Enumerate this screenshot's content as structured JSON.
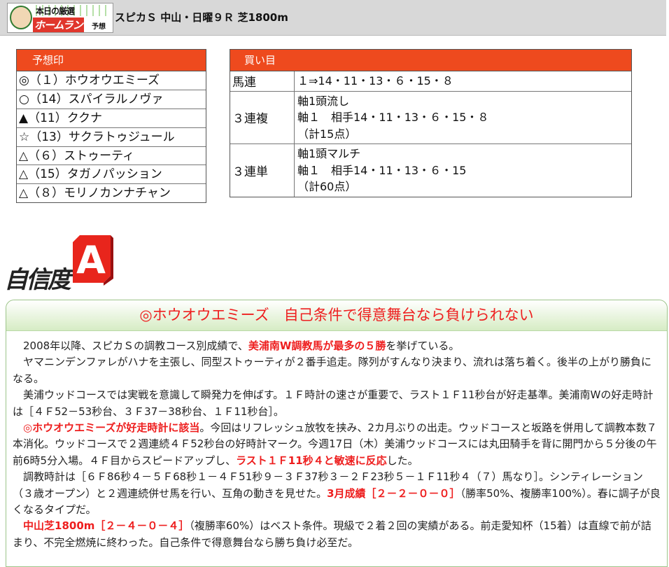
{
  "header": {
    "logo": {
      "line1": "本日の厳選",
      "line2": "ホームラン",
      "line3": "予想"
    },
    "race_title": "スピカＳ 中山・日曜９Ｒ 芝1800m"
  },
  "marks": {
    "heading": "予想印",
    "rows": [
      "◎（１）ホウオウエミーズ",
      "○（14）スパイラルノヴァ",
      "▲（11）ククナ",
      "☆（13）サクラトゥジュール",
      "△（６）ストゥーティ",
      "△（15）タガノパッション",
      "△（８）モリノカンナチャン"
    ]
  },
  "bets": {
    "heading": "買い目",
    "rows": [
      {
        "type": "馬連",
        "lines": [
          "１⇒14・11・13・６・15・８"
        ]
      },
      {
        "type": "３連複",
        "lines": [
          "軸1頭流し",
          "軸１　相手14・11・13・６・15・８",
          "（計15点）"
        ]
      },
      {
        "type": "３連単",
        "lines": [
          "軸1頭マルチ",
          "軸１　相手14・11・13・６・15",
          "（計60点）"
        ]
      }
    ]
  },
  "confidence": {
    "label": "自信度",
    "grade": "A"
  },
  "article": {
    "headline": "◎ホウオウエミーズ　自己条件で得意舞台なら負けられない",
    "p1": [
      "　2008年以降、スピカＳの調教コース別成績で、",
      "美浦南W調教馬が最多の５勝",
      "を挙げている。"
    ],
    "p2": "　ヤマニンデンファレがハナを主張し、同型ストゥーティが２番手追走。隊列がすんなり決まり、流れは落ち着く。後半の上がり勝負になる。",
    "p3": "　美浦ウッドコースでは実戦を意識して瞬発力を伸ばす。１Ｆ時計の速さが重要で、ラスト１Ｆ11秒台が好走基準。美浦南Wの好走時計は［４Ｆ52－53秒台、３Ｆ37－38秒台、１Ｆ11秒台］。",
    "p4": [
      "　",
      "◎ホウオウエミーズが好走時計に該当",
      "。今回はリフレッシュ放牧を挟み、2カ月ぶりの出走。ウッドコースと坂路を併用して調教本数７本消化。ウッドコースで２週連続４Ｆ52秒台の好時計マーク。今週17日（木）美浦ウッドコースには丸田騎手を背に開門から５分後の午前6時5分入場。４Ｆ目からスピードアップし、",
      "ラスト１Ｆ11秒４と敏速に反応",
      "した。"
    ],
    "p5": [
      "　調教時計は［６Ｆ86秒４－５Ｆ68秒１－４Ｆ51秒９－３Ｆ37秒３－２Ｆ23秒５－１Ｆ11秒４（７）馬なり］。シンティレーション（３歳オープン）と２週連続併せ馬を行い、互角の動きを見せた。",
      "3月成績［２－２－０－０］",
      "（勝率50%、複勝率100%）。春に調子が良くなるタイプだ。"
    ],
    "p6": [
      "　",
      "中山芝1800m［２－４－０－４］",
      "（複勝率60%）はベスト条件。現級で２着２回の実績がある。前走愛知杯（15着）は直線で前が詰まり、不完全燃焼に終わった。自己条件で得意舞台なら勝ち負け必至だ。"
    ]
  }
}
